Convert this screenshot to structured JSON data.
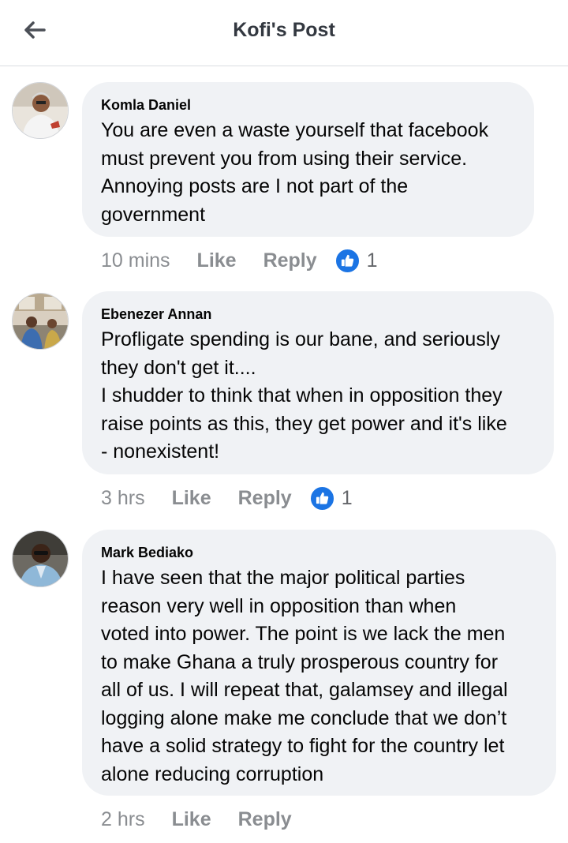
{
  "header": {
    "title": "Kofi's Post"
  },
  "comments": [
    {
      "author": "Komla Daniel",
      "lines": [
        "You are even a waste yourself that facebook",
        "must prevent you from using their service.",
        "Annoying posts are I not part of the",
        "government"
      ],
      "time": "10 mins",
      "like_label": "Like",
      "reply_label": "Reply",
      "reaction_count": "1"
    },
    {
      "author": "Ebenezer Annan",
      "lines": [
        "Profligate spending is our bane, and seriously",
        "they don't get it....",
        "I shudder to think that when in opposition they",
        "raise points as this, they get power and it's like",
        "- nonexistent!"
      ],
      "time": "3 hrs",
      "like_label": "Like",
      "reply_label": "Reply",
      "reaction_count": "1"
    },
    {
      "author": "Mark Bediako",
      "lines": [
        "I have seen that the major political parties",
        "reason very well in opposition than when",
        "voted into power. The point is we lack the men",
        "to make Ghana a truly prosperous country for",
        "all of us. I will repeat that, galamsey and illegal",
        "logging alone make me conclude that we don’t",
        "have a solid strategy to fight for the country let",
        "alone reducing corruption"
      ],
      "time": "2 hrs",
      "like_label": "Like",
      "reply_label": "Reply"
    }
  ],
  "colors": {
    "bubble": "#f0f2f5",
    "like_blue": "#1b74e4",
    "meta_gray": "#8a8d91"
  }
}
